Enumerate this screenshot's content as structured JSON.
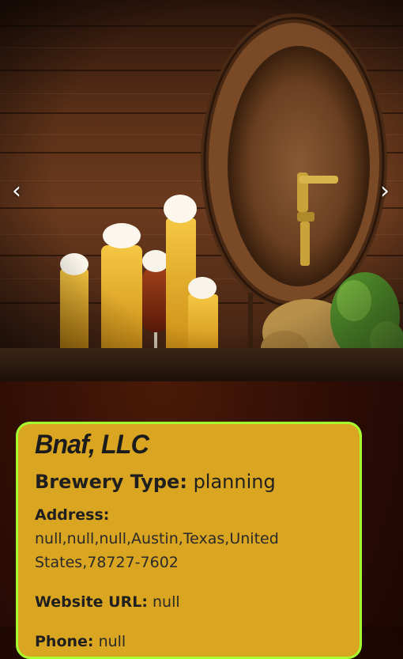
{
  "carousel": {
    "prev_label": "‹",
    "next_label": "›",
    "image_subject": "beer-glasses-and-barrel"
  },
  "brewery": {
    "name": "Bnaf, LLC",
    "type_label": "Brewery Type:",
    "type_value": "planning",
    "address_label": "Address:",
    "address_value": "null,null,null,Austin,Texas,United States,78727-7602",
    "website_label": "Website URL:",
    "website_value": "null",
    "phone_label": "Phone:",
    "phone_value": "null"
  },
  "colors": {
    "card_bg": "#daa520",
    "card_border": "#a6ff2e",
    "page_bg": "#2b0c04"
  }
}
